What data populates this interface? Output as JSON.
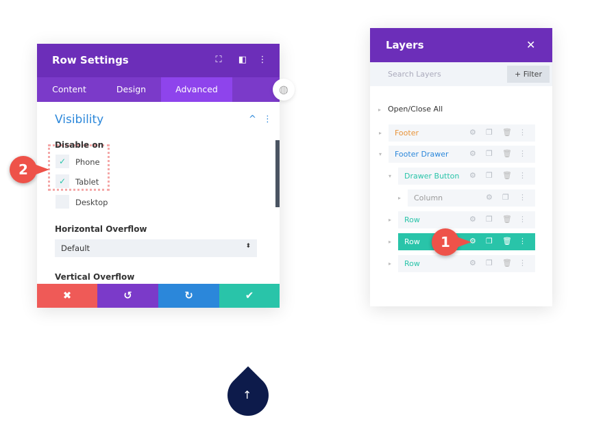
{
  "row_settings": {
    "title": "Row Settings",
    "tabs": [
      "Content",
      "Design",
      "Advanced"
    ],
    "active_tab": "Advanced",
    "section": "Visibility",
    "disable_on_label": "Disable on",
    "options": [
      {
        "label": "Phone",
        "checked": true
      },
      {
        "label": "Tablet",
        "checked": true
      },
      {
        "label": "Desktop",
        "checked": false
      }
    ],
    "h_overflow_label": "Horizontal Overflow",
    "h_overflow_value": "Default",
    "v_overflow_label": "Vertical Overflow"
  },
  "layers": {
    "title": "Layers",
    "close": "✕",
    "search_placeholder": "Search Layers",
    "filter_label": "+ Filter",
    "open_close": "Open/Close All",
    "items": [
      {
        "name": "Footer",
        "color": "#e8943a"
      },
      {
        "name": "Footer Drawer",
        "color": "#2b87da"
      },
      {
        "name": "Drawer Button",
        "color": "#29c4a9"
      },
      {
        "name": "Column",
        "color": "#999999"
      },
      {
        "name": "Row",
        "color": "#29c4a9"
      },
      {
        "name": "Row",
        "color": "#ffffff",
        "active": true
      },
      {
        "name": "Row",
        "color": "#29c4a9"
      }
    ]
  },
  "badges": [
    "1",
    "2"
  ],
  "colors": {
    "purple": "#6c2eb9",
    "teal": "#29c4a9",
    "red": "#ef5a57",
    "blue": "#2b87da"
  }
}
